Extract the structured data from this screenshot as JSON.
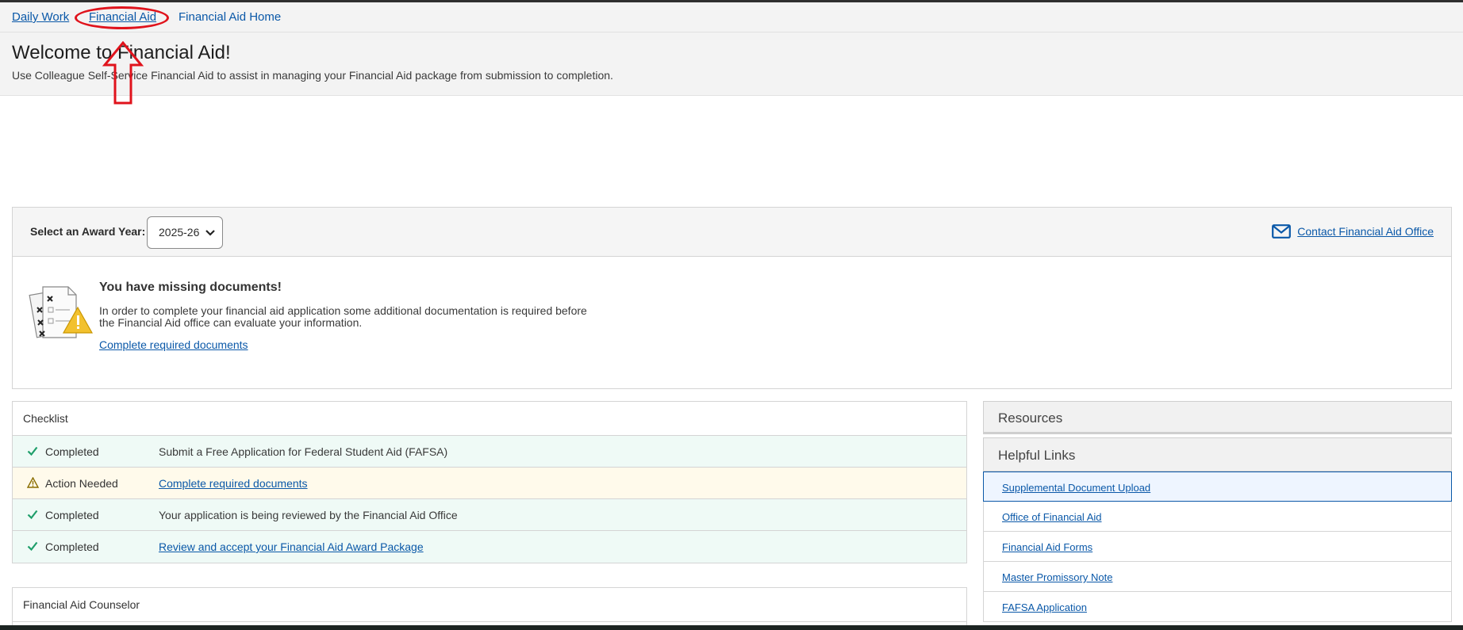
{
  "breadcrumb": {
    "items": [
      {
        "label": "Daily Work"
      },
      {
        "label": "Financial Aid"
      },
      {
        "label": "Financial Aid Home"
      }
    ]
  },
  "header": {
    "title": "Welcome to Financial Aid!",
    "subtitle": "Use Colleague Self-Service Financial Aid to assist in managing your Financial Aid package from submission to completion."
  },
  "award_year": {
    "label": "Select an Award Year:",
    "selected": "2025-26",
    "contact_label": "Contact Financial Aid Office"
  },
  "missing_docs": {
    "title": "You have missing documents!",
    "message": "In order to complete your financial aid application some additional documentation is required before the Financial Aid office can evaluate your information.",
    "link": "Complete required documents"
  },
  "checklist": {
    "title": "Checklist",
    "rows": [
      {
        "status": "Completed",
        "task": "Submit a Free Application for Federal Student Aid (FAFSA)",
        "icon": "check-icon"
      },
      {
        "status": "Action Needed",
        "task": "Complete required documents",
        "icon": "warning-icon"
      },
      {
        "status": "Completed",
        "task": "Your application is being reviewed by the Financial Aid Office",
        "icon": "check-icon"
      },
      {
        "status": "Completed",
        "task": "Review and accept your Financial Aid Award Package",
        "icon": "check-icon"
      }
    ]
  },
  "counselor": {
    "title": "Financial Aid Counselor"
  },
  "resources": {
    "title": "Resources",
    "helpful_title": "Helpful Links",
    "links": [
      "Supplemental Document Upload",
      "Office of Financial Aid",
      "Financial Aid Forms",
      "Master Promissory Note",
      "FAFSA Application"
    ]
  },
  "colors": {
    "link": "#0a58a8",
    "success": "#1e9e6a",
    "warning": "#b8860b",
    "annotation": "#e0131c"
  }
}
